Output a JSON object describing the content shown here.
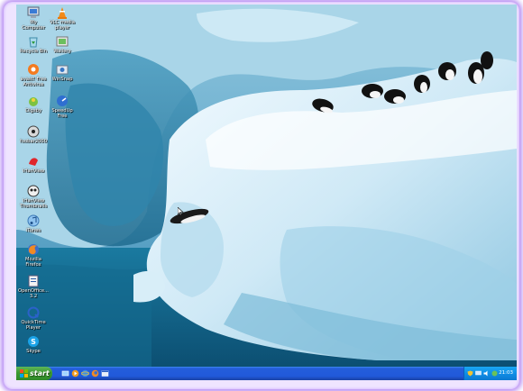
{
  "desktop": {
    "icons": [
      {
        "label": "My Computer",
        "icon": "computer-icon"
      },
      {
        "label": "VLC media player",
        "icon": "vlc-cone-icon"
      },
      {
        "label": "Recycle Bin",
        "icon": "recycle-bin-icon"
      },
      {
        "label": "Wallery",
        "icon": "wallery-icon"
      },
      {
        "label": "avast! Free Antivirus",
        "icon": "avast-icon"
      },
      {
        "label": "WinSnap",
        "icon": "winsnap-icon"
      },
      {
        "label": "Digsby",
        "icon": "digsby-icon"
      },
      {
        "label": "SpeedUp Free",
        "icon": "speedup-icon"
      },
      {
        "label": "foobar2000",
        "icon": "foobar-icon"
      },
      {
        "label": "IrfanView",
        "icon": "irfanview-icon"
      },
      {
        "label": "IrfanView Thumbnails",
        "icon": "irfanview-thumbnails-icon"
      },
      {
        "label": "iTunes",
        "icon": "itunes-icon"
      },
      {
        "label": "Mozilla Firefox",
        "icon": "firefox-icon"
      },
      {
        "label": "OpenOffice... 3.2",
        "icon": "openoffice-icon"
      },
      {
        "label": "QuickTime Player",
        "icon": "quicktime-icon"
      },
      {
        "label": "Skype",
        "icon": "skype-icon"
      }
    ],
    "pointer": "mouse-pointer-icon",
    "wallpaper": "penguins-on-iceberg"
  },
  "taskbar": {
    "start_label": "start",
    "quick_launch": [
      "show-desktop-icon",
      "media-player-icon",
      "internet-explorer-icon",
      "firefox-icon",
      "window-icon"
    ],
    "tray_icons": [
      "shield-tray-icon",
      "network-tray-icon",
      "volume-tray-icon",
      "update-tray-icon"
    ],
    "clock": "21:03"
  },
  "colors": {
    "taskbar_blue": "#245edb",
    "start_green": "#3d9a32",
    "tray_blue": "#0f8ee6",
    "frame_purple": "#b78df2"
  }
}
